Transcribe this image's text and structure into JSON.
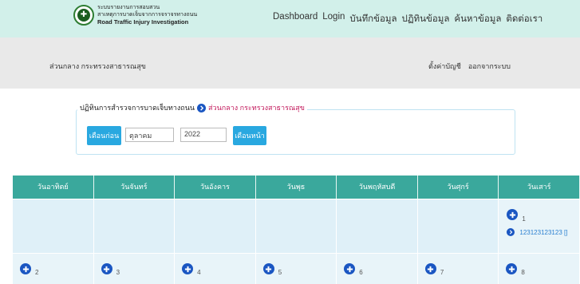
{
  "header": {
    "logo_line1": "ระบบรายงานการสอบสวน",
    "logo_line2": "สาเหตุการบาดเจ็บจากการจราจรทางถนน",
    "logo_line3": "Road Traffic Injury Investigation",
    "nav": [
      "Dashboard",
      "Login",
      "บันทึกข้อมูล",
      "ปฏิทินข้อมูล",
      "ค้นหาข้อมูล",
      "ติดต่อเรา"
    ]
  },
  "subbar": {
    "org": "ส่วนกลาง กระทรวงสาธารณสุข",
    "settings": "ตั้งค่าบัญชี",
    "logout": "ออกจากระบบ"
  },
  "panel": {
    "title": "ปฏิทินการสำรวจการบาดเจ็บทางถนน",
    "org": "ส่วนกลาง กระทรวงสาธารณสุข",
    "prev_label": "เดือนก่อน",
    "month_value": "ตุลาคม",
    "year_value": "2022",
    "next_label": "เดือนหน้า"
  },
  "calendar": {
    "days": [
      "วันอาทิตย์",
      "วันจันทร์",
      "วันอังคาร",
      "วันพุธ",
      "วันพฤหัสบดี",
      "วันศุกร์",
      "วันเสาร์"
    ],
    "week1": {
      "saturday_day": "1",
      "event": "123123123123 []"
    },
    "week2": [
      "2",
      "3",
      "4",
      "5",
      "6",
      "7",
      "8"
    ]
  },
  "colors": {
    "header_bg": "#d2f0ea",
    "subbar_bg": "#e9e9e9",
    "button": "#29a8e0",
    "calendar_header": "#3aa89c",
    "calendar_cell": "#dff0f8",
    "icon": "#1a56c2",
    "legend_accent": "#c2185b"
  }
}
